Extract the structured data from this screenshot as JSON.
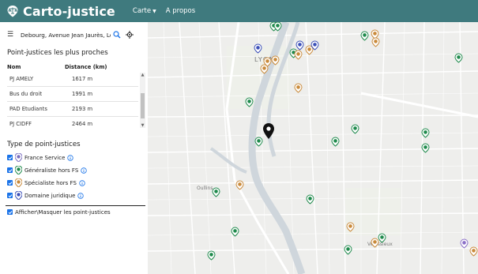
{
  "header": {
    "brand": "Carto-justice",
    "nav": [
      {
        "label": "Carte",
        "has_caret": true
      },
      {
        "label": "A propos",
        "has_caret": false
      }
    ]
  },
  "search": {
    "value": "Debourg, Avenue Jean Jaurès, Le B"
  },
  "nearest": {
    "title": "Point-justices les plus proches",
    "columns": [
      "Nom",
      "Distance (km)"
    ],
    "rows": [
      {
        "name": "PJ AMELY",
        "distance": "1617 m"
      },
      {
        "name": "Bus du droit",
        "distance": "1991 m"
      },
      {
        "name": "PAD Etudiants",
        "distance": "2193 m"
      },
      {
        "name": "PJ CIDFF",
        "distance": "2464 m"
      }
    ]
  },
  "types": {
    "title": "Type de point-justices",
    "items": [
      {
        "label": "France Service",
        "color": "#7b6fbf"
      },
      {
        "label": "Généraliste hors FS",
        "color": "#1f8a4c"
      },
      {
        "label": "Spécialiste hors FS",
        "color": "#c98a3b"
      },
      {
        "label": "Domaine juridique",
        "color": "#3b4fb8"
      }
    ],
    "toggle_all": "Afficher\\Masquer les point-justices"
  },
  "map": {
    "labels": [
      "LYON",
      "Oullins",
      "Vénissieux"
    ],
    "colors": {
      "green": "#1f8a4c",
      "orange": "#c98a3b",
      "blue": "#3b4fb8",
      "purple": "#8a6fc7",
      "water": "#cfd6dc"
    }
  }
}
